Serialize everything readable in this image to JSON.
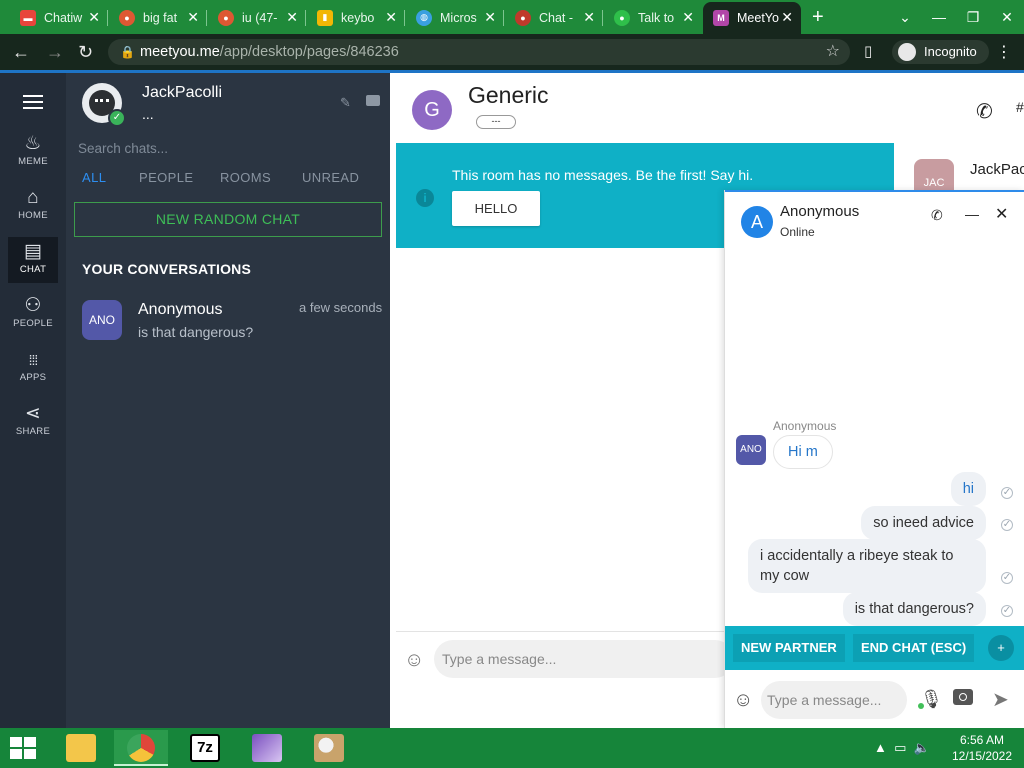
{
  "browser": {
    "tabs": [
      {
        "title": "Chatiw",
        "icon": "chatiw-favicon",
        "color": "#e8453c"
      },
      {
        "title": "big fat",
        "icon": "duckduckgo-favicon",
        "color": "#de5833"
      },
      {
        "title": "iu (47-",
        "icon": "duckduckgo-favicon",
        "color": "#de5833"
      },
      {
        "title": "keybo",
        "icon": "shopping-bag-favicon",
        "color": "#f2b705"
      },
      {
        "title": "Micros",
        "icon": "globe-favicon",
        "color": "#3aa0e0"
      },
      {
        "title": "Chat -",
        "icon": "chat-favicon",
        "color": "#c0392b"
      },
      {
        "title": "Talk to",
        "icon": "talk-favicon",
        "color": "#2fbf4a"
      },
      {
        "title": "MeetYo",
        "icon": "meetyou-favicon",
        "color": "#b246a8",
        "active": true
      }
    ],
    "url_host": "meetyou.me",
    "url_path": "/app/desktop/pages/846236",
    "incognito_label": "Incognito"
  },
  "leftnav": {
    "items": [
      {
        "label": "MEME",
        "icon": "flame-icon",
        "glyph": "🔥"
      },
      {
        "label": "HOME",
        "icon": "home-icon",
        "glyph": "⌂"
      },
      {
        "label": "CHAT",
        "icon": "chat-icon",
        "glyph": "▤",
        "active": true
      },
      {
        "label": "PEOPLE",
        "icon": "people-icon",
        "glyph": "👥"
      },
      {
        "label": "APPS",
        "icon": "apps-grid-icon",
        "glyph": "⋮⋮⋮"
      },
      {
        "label": "SHARE",
        "icon": "share-icon",
        "glyph": "⋖"
      }
    ]
  },
  "profile": {
    "name": "JackPacolli",
    "status": "..."
  },
  "conversations": {
    "search_placeholder": "Search chats...",
    "filters": [
      "ALL",
      "PEOPLE",
      "ROOMS",
      "UNREAD"
    ],
    "new_random_label": "NEW RANDOM CHAT",
    "heading": "YOUR CONVERSATIONS",
    "items": [
      {
        "avatar": "ANO",
        "name": "Anonymous",
        "last_message": "is that dangerous?",
        "time": "a few seconds"
      }
    ]
  },
  "room": {
    "avatar_letter": "G",
    "name": "Generic",
    "tag": "---",
    "banner_text": "This room has no messages. Be the first! Say hi.",
    "hello_label": "HELLO",
    "member": {
      "avatar": "JAC",
      "name": "JackPac"
    },
    "input_placeholder": "Type a message...",
    "hash_label": "#"
  },
  "popup": {
    "avatar_letter": "A",
    "name": "Anonymous",
    "status": "Online",
    "incoming": {
      "sender": "Anonymous",
      "avatar": "ANO",
      "text": "Hi m"
    },
    "outgoing": [
      "hi",
      "so ineed advice",
      "i accidentally a ribeye steak to my cow",
      "is that dangerous?"
    ],
    "new_partner_label": "NEW PARTNER",
    "end_chat_label": "END CHAT (ESC)",
    "input_placeholder": "Type a message..."
  },
  "taskbar": {
    "apps": [
      "file-explorer",
      "chrome",
      "7zip",
      "winrar",
      "paint"
    ],
    "time": "6:56 AM",
    "date": "12/15/2022"
  }
}
